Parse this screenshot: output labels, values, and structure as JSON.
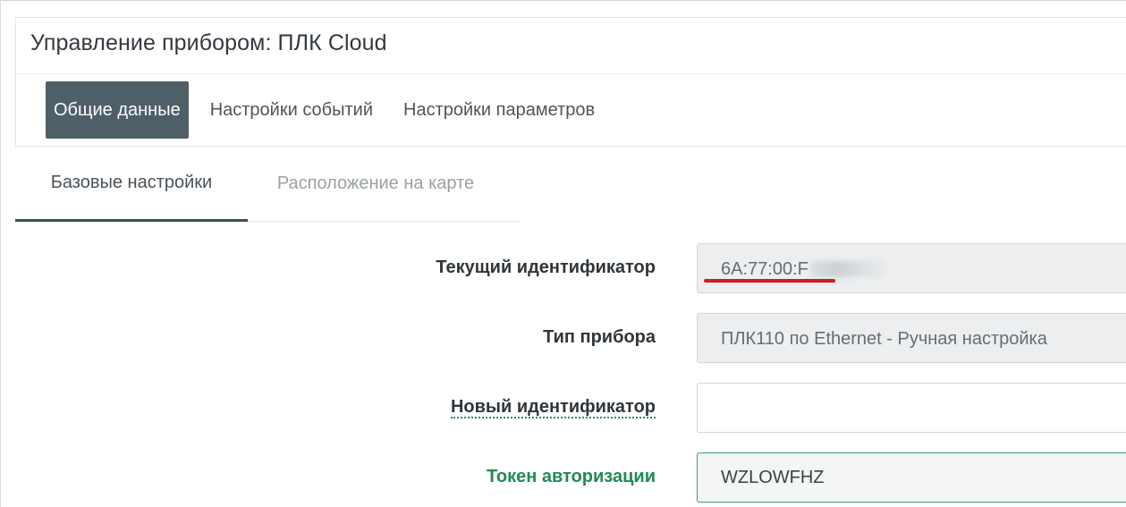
{
  "header": {
    "title": "Управление прибором: ПЛК Cloud"
  },
  "main_tabs": [
    {
      "label": "Общие данные",
      "active": true
    },
    {
      "label": "Настройки событий",
      "active": false
    },
    {
      "label": "Настройки параметров",
      "active": false
    }
  ],
  "sub_tabs": [
    {
      "label": "Базовые настройки",
      "active": true
    },
    {
      "label": "Расположение на карте",
      "active": false
    }
  ],
  "form": {
    "current_id": {
      "label": "Текущий идентификатор",
      "value": "6A:77:00:F"
    },
    "device_type": {
      "label": "Тип прибора",
      "value": "ПЛК110 по Ethernet - Ручная настройка"
    },
    "new_id": {
      "label": "Новый идентификатор",
      "value": ""
    },
    "auth_token": {
      "label": "Токен авторизации",
      "value": "WZLOWFHZ"
    }
  },
  "colors": {
    "active_tab_bg": "#4f5f68",
    "success_label": "#1f8a55",
    "success_border": "#3aa06b",
    "annotation_red": "#d01c1c"
  }
}
